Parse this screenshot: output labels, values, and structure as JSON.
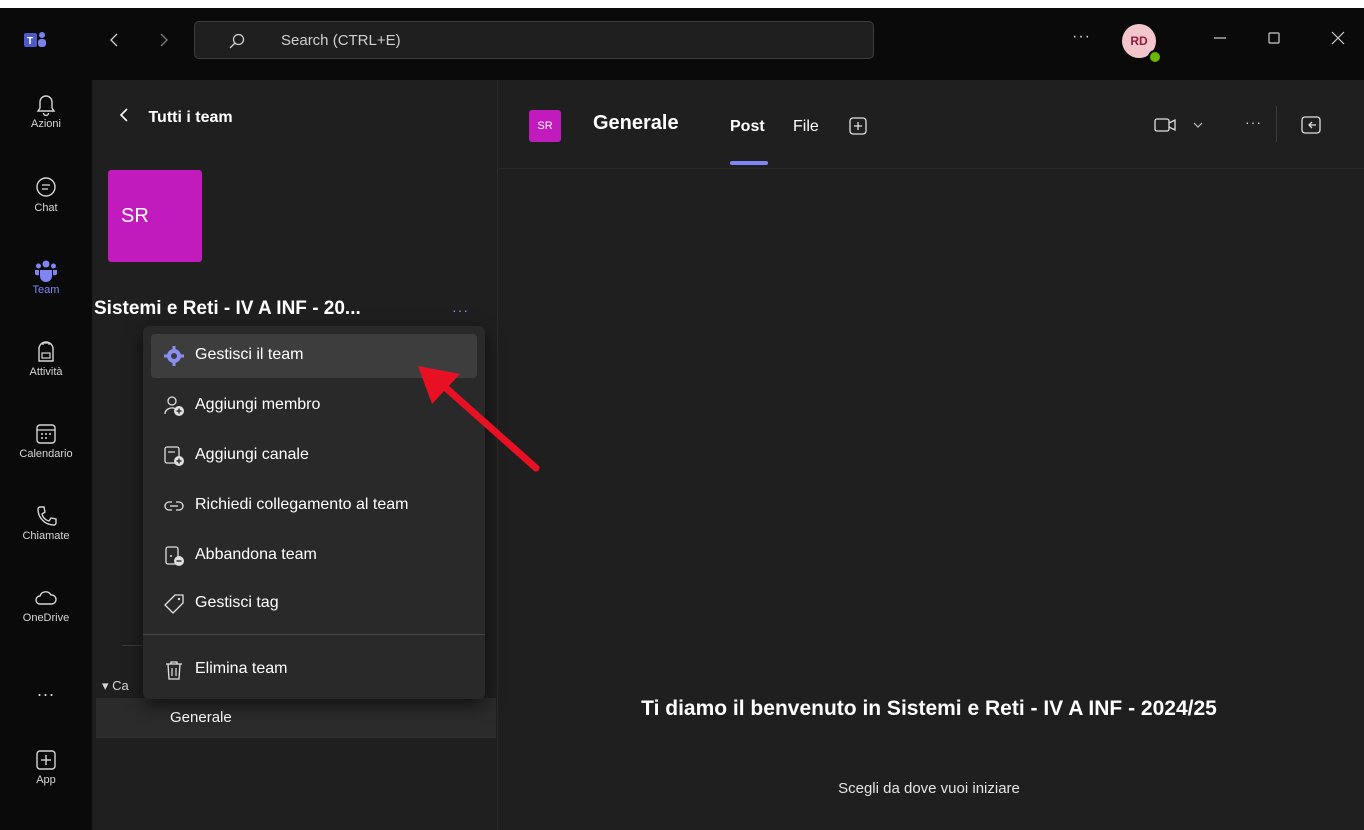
{
  "titlebar": {
    "search_placeholder": "Search (CTRL+E)",
    "more": "···",
    "avatar_initials": "RD"
  },
  "rail": [
    {
      "label": "Azioni",
      "icon": "bell-icon"
    },
    {
      "label": "Chat",
      "icon": "chat-icon"
    },
    {
      "label": "Team",
      "icon": "teams-icon"
    },
    {
      "label": "Attività",
      "icon": "backpack-icon"
    },
    {
      "label": "Calendario",
      "icon": "calendar-icon"
    },
    {
      "label": "Chiamate",
      "icon": "phone-icon"
    },
    {
      "label": "OneDrive",
      "icon": "cloud-icon"
    },
    {
      "label": "...",
      "icon": "more-icon"
    },
    {
      "label": "App",
      "icon": "add-app-icon"
    }
  ],
  "team_panel": {
    "back_label": "Tutti i team",
    "team_initials": "SR",
    "team_name": "Sistemi e Reti - IV A INF - 20...",
    "more": "···",
    "channels_header": "▾ Ca",
    "channel": "Generale"
  },
  "menu": {
    "items": [
      {
        "label": "Gestisci il team",
        "icon": "gear-icon"
      },
      {
        "label": "Aggiungi membro",
        "icon": "add-person-icon"
      },
      {
        "label": "Aggiungi canale",
        "icon": "add-channel-icon"
      },
      {
        "label": "Richiedi collegamento al team",
        "icon": "link-icon"
      },
      {
        "label": "Abbandona team",
        "icon": "leave-icon"
      },
      {
        "label": "Gestisci tag",
        "icon": "tag-icon"
      },
      {
        "label": "Elimina team",
        "icon": "trash-icon"
      }
    ]
  },
  "main": {
    "channel_initials": "SR",
    "channel_title": "Generale",
    "tabs": [
      {
        "label": "Post"
      },
      {
        "label": "File"
      }
    ],
    "more": "···",
    "welcome_title": "Ti diamo il benvenuto in Sistemi e Reti - IV A INF - 2024/25",
    "welcome_sub": "Scegli da dove vuoi iniziare"
  },
  "colors": {
    "accent": "#7f85f5",
    "team_color": "#c21bbd",
    "annotation_arrow": "#e81123"
  }
}
